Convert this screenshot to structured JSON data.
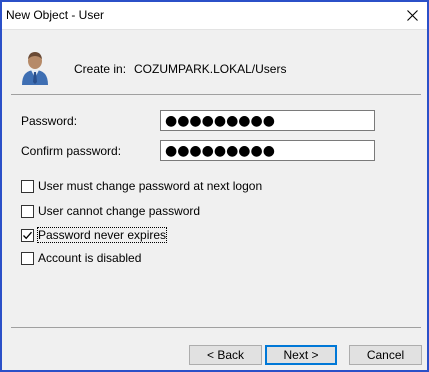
{
  "window": {
    "title": "New Object - User"
  },
  "header": {
    "create_label": "Create in:",
    "create_path": "COZUMPARK.LOKAL/Users"
  },
  "form": {
    "password_label": "Password:",
    "password_value": "●●●●●●●●●",
    "confirm_label": "Confirm password:",
    "confirm_value": "●●●●●●●●●"
  },
  "options": [
    {
      "label": "User must change password at next logon",
      "checked": false
    },
    {
      "label": "User cannot change password",
      "checked": false
    },
    {
      "label": "Password never expires",
      "checked": true
    },
    {
      "label": "Account is disabled",
      "checked": false
    }
  ],
  "buttons": {
    "back": "< Back",
    "next": "Next >",
    "cancel": "Cancel"
  },
  "icons": {
    "close": "close-icon",
    "user": "user-icon",
    "check": "checkmark-icon"
  },
  "colors": {
    "window_border": "#2b50c8",
    "default_button_border": "#0078d7"
  }
}
